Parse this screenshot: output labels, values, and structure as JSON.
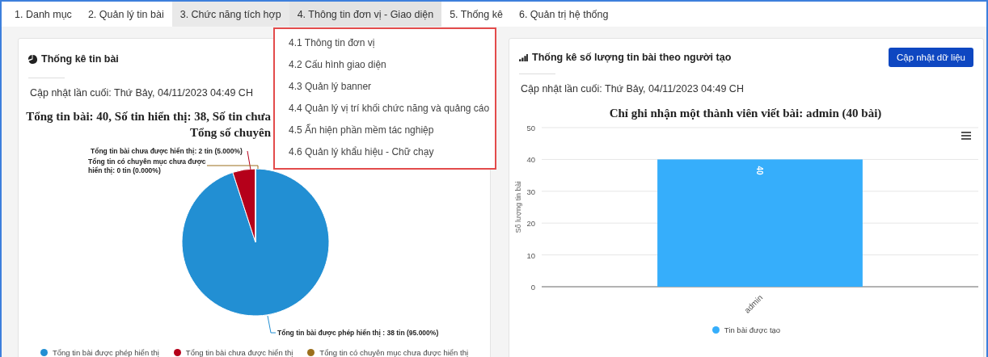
{
  "tabs": [
    {
      "label": "1. Danh mục",
      "selected": false,
      "open": false
    },
    {
      "label": "2. Quản lý tin bài",
      "selected": false,
      "open": false
    },
    {
      "label": "3. Chức năng tích hợp",
      "selected": true,
      "open": false
    },
    {
      "label": "4. Thông tin đơn vị - Giao diện",
      "selected": false,
      "open": true
    },
    {
      "label": "5. Thống kê",
      "selected": false,
      "open": false
    },
    {
      "label": "6. Quản trị hệ thống",
      "selected": false,
      "open": false
    }
  ],
  "dropdown": {
    "items": [
      "4.1 Thông tin đơn vị",
      "4.2 Cấu hình giao diện",
      "4.3 Quản lý banner",
      "4.4 Quản lý vị trí khối chức năng và quảng cáo",
      "4.5 Ẩn hiện phần mềm tác nghiệp",
      "4.6 Quản lý khẩu hiệu - Chữ chạy"
    ]
  },
  "left_card": {
    "title": "Thống kê tin bài",
    "updated": "Cập nhật lần cuối: Thứ Bảy, 04/11/2023 04:49 CH",
    "chart_title_lines": [
      "Tổng tin bài: 40, Số tin hiển thị: 38, Số tin chưa",
      "Tổng số chuyên"
    ],
    "chart_data": {
      "type": "pie",
      "categories": [
        "Tổng tin bài được phép hiển thị",
        "Tổng tin bài chưa được hiển thị",
        "Tổng tin có chuyên mục chưa được hiển thị"
      ],
      "values": [
        95,
        5,
        0
      ],
      "legend": "bottom",
      "colors": [
        "#228fd3",
        "#b5001a",
        "#9b6f1c"
      ],
      "annotations": [
        "Tổng tin bài được phép hiển thị : 38 tin (95.000%)",
        "Tổng tin bài chưa được hiển thị: 2 tin (5.000%)",
        "Tổng tin có chuyên mục chưa được hiển thị: 0 tin (0.000%)"
      ]
    }
  },
  "right_card": {
    "title": "Thống kê số lượng tin bài theo người tạo",
    "button": "Cập nhật dữ liệu",
    "updated": "Cập nhật lần cuối: Thứ Bảy, 04/11/2023 04:49 CH",
    "chart_data": {
      "type": "bar",
      "title": "Chỉ ghi nhận một thành viên viết bài: admin (40 bài)",
      "ylabel": "Số lượng tin bài",
      "categories": [
        "admin"
      ],
      "series": [
        {
          "name": "Tin bài được tạo",
          "color": "#36aefb",
          "values": [
            40
          ]
        }
      ],
      "ylim": [
        0,
        50
      ],
      "grid": true,
      "legend": "bottom",
      "yticks": [
        0,
        10,
        20,
        30,
        40,
        50
      ],
      "data_labels": true
    }
  }
}
